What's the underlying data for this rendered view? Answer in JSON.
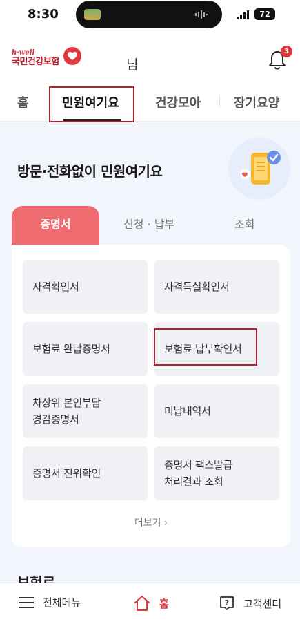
{
  "status_bar": {
    "time": "8:30",
    "battery": "72"
  },
  "header": {
    "logo_hwell": "h·well",
    "logo_name": "국민건강보험",
    "user_suffix": "님",
    "notification_count": "3"
  },
  "tabs": [
    {
      "label": "홈"
    },
    {
      "label": "민원여기요"
    },
    {
      "label": "건강모아"
    },
    {
      "label": "장기요양"
    }
  ],
  "hero": {
    "title": "방문·전화없이 민원여기요"
  },
  "subtabs": [
    {
      "label": "증명서"
    },
    {
      "label": "신청 · 납부"
    },
    {
      "label": "조회"
    }
  ],
  "certificates": [
    {
      "label": "자격확인서"
    },
    {
      "label": "자격득실확인서"
    },
    {
      "label": "보험료 완납증명서"
    },
    {
      "label": "보험료 납부확인서"
    },
    {
      "label": "차상위 본인부담\n경감증명서"
    },
    {
      "label": "미납내역서"
    },
    {
      "label": "증명서 진위확인"
    },
    {
      "label": "증명서 팩스발급\n처리결과 조회"
    }
  ],
  "more_label": "더보기",
  "next_section_title": "보험료",
  "bottom_nav": {
    "menu": "전체메뉴",
    "home": "홈",
    "customer_center": "고객센터"
  },
  "colors": {
    "brand_red": "#e2363e",
    "subtab_active": "#ee6b6f",
    "content_bg": "#f2f5fb",
    "highlight_box": "#b5212d"
  }
}
